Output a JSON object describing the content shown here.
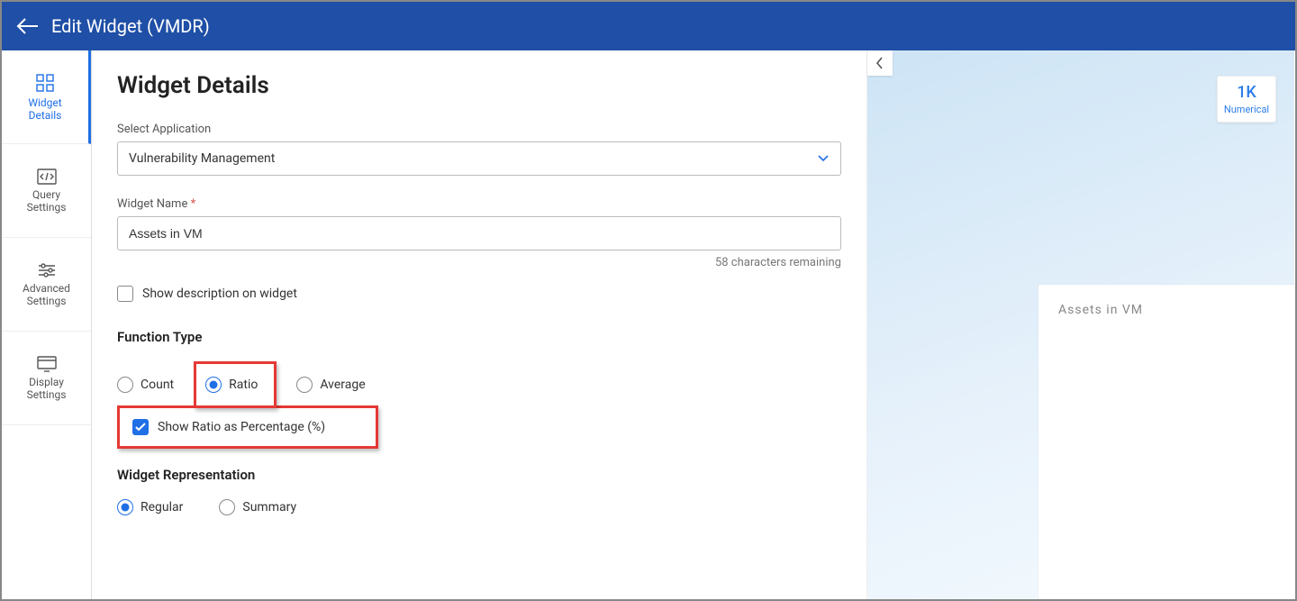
{
  "header": {
    "title": "Edit Widget (VMDR)"
  },
  "sidebar": {
    "items": [
      {
        "label1": "Widget",
        "label2": "Details",
        "active": true
      },
      {
        "label1": "Query",
        "label2": "Settings"
      },
      {
        "label1": "Advanced",
        "label2": "Settings"
      },
      {
        "label1": "Display",
        "label2": "Settings"
      }
    ]
  },
  "form": {
    "heading": "Widget Details",
    "app_label": "Select Application",
    "app_value": "Vulnerability Management",
    "name_label": "Widget Name",
    "name_required": "*",
    "name_value": "Assets in VM",
    "name_hint": "58 characters remaining",
    "show_desc_label": "Show description on widget",
    "show_desc_checked": false,
    "function_type_label": "Function Type",
    "function_options": [
      "Count",
      "Ratio",
      "Average"
    ],
    "function_selected": "Ratio",
    "show_ratio_pct_label": "Show Ratio as Percentage (%)",
    "show_ratio_pct_checked": true,
    "representation_label": "Widget Representation",
    "representation_options": [
      "Regular",
      "Summary"
    ],
    "representation_selected": "Regular"
  },
  "preview": {
    "chip_value": "1K",
    "chip_label": "Numerical",
    "card_title": "Assets in VM"
  }
}
